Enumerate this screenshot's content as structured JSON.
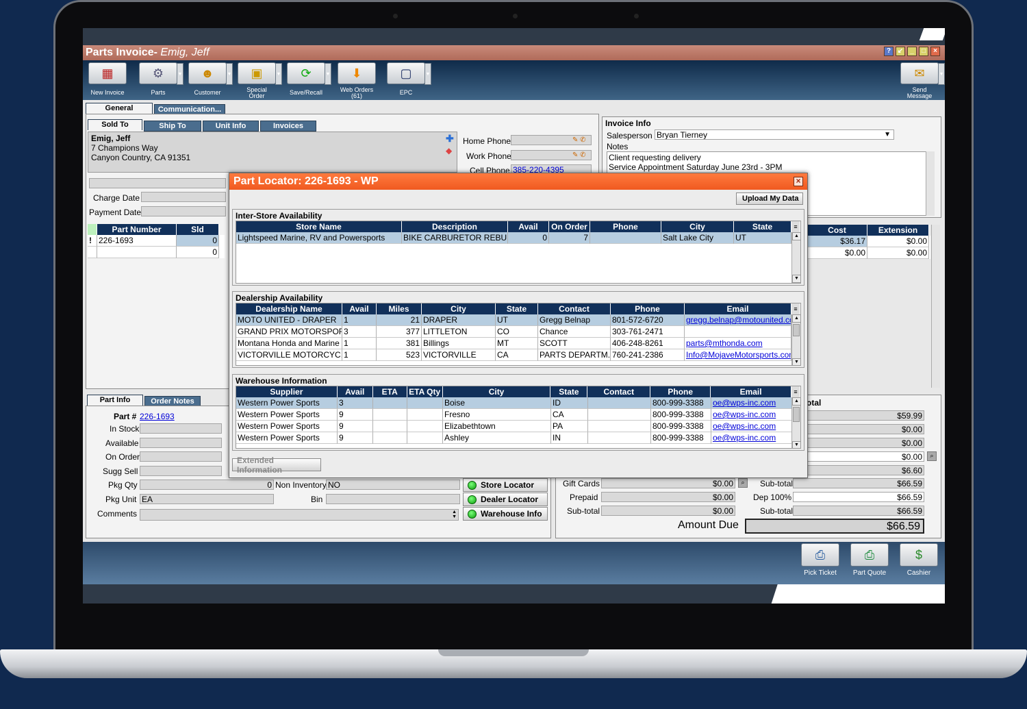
{
  "window": {
    "title": "Parts Invoice-",
    "customer": "Emig, Jeff"
  },
  "toolbar": {
    "new_invoice": "New Invoice",
    "parts": "Parts",
    "customer": "Customer",
    "special_order_1": "Special",
    "special_order_2": "Order",
    "save_recall": "Save/Recall",
    "web_orders_1": "Web Orders",
    "web_orders_2": "(61)",
    "epc": "EPC",
    "send_message_1": "Send",
    "send_message_2": "Message"
  },
  "tabs": {
    "general": "General",
    "communication": "Communication..."
  },
  "subtabs": {
    "sold_to": "Sold To",
    "ship_to": "Ship To",
    "unit_info": "Unit Info",
    "invoices": "Invoices"
  },
  "sold_to": {
    "name": "Emig, Jeff",
    "address1": "7 Champions Way",
    "address2": "Canyon Country, CA 91351",
    "home_phone_label": "Home Phone",
    "work_phone_label": "Work Phone",
    "cell_phone_label": "Cell Phone",
    "cell_phone": "385-220-4395",
    "charge_date_label": "Charge Date",
    "payment_date_label": "Payment Date"
  },
  "invoice_info": {
    "title": "Invoice Info",
    "salesperson_label": "Salesperson",
    "salesperson": "Bryan Tierney",
    "notes_label": "Notes",
    "note1": "Client requesting delivery",
    "note2": "Service Appointment Saturday June 23rd - 3PM"
  },
  "parts_grid": {
    "headers": {
      "part_number": "Part Number",
      "sld": "Sld",
      "cost": "Cost",
      "extension": "Extension"
    },
    "rows": [
      {
        "flag": "!",
        "part": "226-1693",
        "sld": "0",
        "cost": "$36.17",
        "ext": "$0.00"
      },
      {
        "flag": "",
        "part": "",
        "sld": "0",
        "cost": "$0.00",
        "ext": "$0.00"
      }
    ]
  },
  "bottom_tabs": {
    "part_info": "Part Info",
    "order_notes": "Order Notes"
  },
  "part_info": {
    "part_label": "Part #",
    "part": "226-1693",
    "in_stock": "In Stock",
    "available": "Available",
    "on_order": "On Order",
    "sugg_sell": "Sugg Sell",
    "pkg_qty": "Pkg Qty",
    "pkg_qty_value": "0",
    "pkg_unit": "Pkg Unit",
    "pkg_unit_value": "EA",
    "non_inventory": "Non Inventory",
    "non_inventory_value": "NO",
    "bin": "Bin",
    "comments": "Comments"
  },
  "locator_buttons": {
    "store": "Store Locator",
    "dealer": "Dealer Locator",
    "warehouse": "Warehouse Info"
  },
  "totals": {
    "total_label": "otal",
    "right_values": [
      "$59.99",
      "$0.00",
      "$0.00",
      "$0.00",
      "$6.60"
    ],
    "gift_cards": "Gift Cards",
    "gift_cards_value": "$0.00",
    "prepaid": "Prepaid",
    "prepaid_value": "$0.00",
    "subtotal": "Sub-total",
    "subtotal_value": "$0.00",
    "sub_total_r1": "Sub-total",
    "sub_total_r1_value": "$66.59",
    "dep": "Dep 100%",
    "dep_value": "$66.59",
    "sub_total_r2": "Sub-total",
    "sub_total_r2_value": "$66.59",
    "amount_due": "Amount Due",
    "amount_due_value": "$66.59"
  },
  "bottombar": {
    "pick_ticket": "Pick Ticket",
    "part_quote": "Part Quote",
    "cashier": "Cashier"
  },
  "dialog": {
    "title": "Part Locator: 226-1693 - WP",
    "upload": "Upload My Data",
    "inter_store": {
      "title": "Inter-Store Availability",
      "headers": [
        "Store Name",
        "Description",
        "Avail",
        "On Order",
        "Phone",
        "City",
        "State"
      ],
      "rows": [
        [
          "Lightspeed Marine, RV and Powersports",
          "BIKE CARBURETOR REBUI...",
          "0",
          "7",
          "",
          "Salt Lake City",
          "UT"
        ]
      ]
    },
    "dealership": {
      "title": "Dealership Availability",
      "headers": [
        "Dealership Name",
        "Avail",
        "Miles",
        "City",
        "State",
        "Contact",
        "Phone",
        "Email"
      ],
      "rows": [
        [
          "MOTO UNITED - DRAPER",
          "1",
          "21",
          "DRAPER",
          "UT",
          "Gregg Belnap",
          "801-572-6720",
          "gregg.belnap@motounited.co"
        ],
        [
          "GRAND PRIX MOTORSPOR...",
          "3",
          "377",
          "LITTLETON",
          "CO",
          "Chance",
          "303-761-2471",
          ""
        ],
        [
          "Montana Honda and Marine",
          "1",
          "381",
          "Billings",
          "MT",
          "SCOTT",
          "406-248-8261",
          "parts@mthonda.com"
        ],
        [
          "VICTORVILLE MOTORCYC...",
          "1",
          "523",
          "VICTORVILLE",
          "CA",
          "PARTS DEPARTM...",
          "760-241-2386",
          "Info@MojaveMotorsports.com"
        ]
      ]
    },
    "warehouse": {
      "title": "Warehouse Information",
      "headers": [
        "Supplier",
        "Avail",
        "ETA",
        "ETA Qty",
        "City",
        "State",
        "Contact",
        "Phone",
        "Email"
      ],
      "rows": [
        [
          "Western Power Sports",
          "3",
          "",
          "",
          "Boise",
          "ID",
          "",
          "800-999-3388",
          "oe@wps-inc.com"
        ],
        [
          "Western Power Sports",
          "9",
          "",
          "",
          "Fresno",
          "CA",
          "",
          "800-999-3388",
          "oe@wps-inc.com"
        ],
        [
          "Western Power Sports",
          "9",
          "",
          "",
          "Elizabethtown",
          "PA",
          "",
          "800-999-3388",
          "oe@wps-inc.com"
        ],
        [
          "Western Power Sports",
          "9",
          "",
          "",
          "Ashley",
          "IN",
          "",
          "800-999-3388",
          "oe@wps-inc.com"
        ]
      ]
    },
    "extended": "Extended Information"
  }
}
